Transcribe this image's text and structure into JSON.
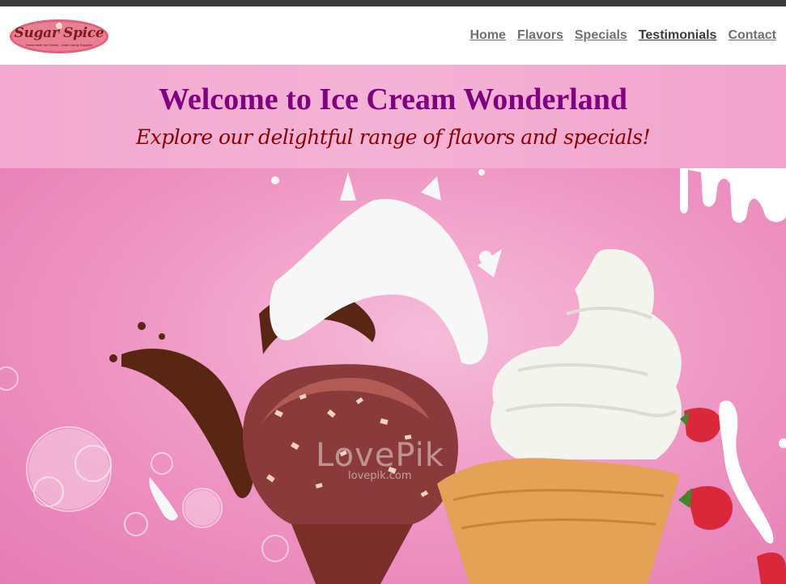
{
  "brand": {
    "logo_text": "Sugar Spice",
    "logo_tagline": "Homemade Ice Cream · Cake Candy Supplies"
  },
  "nav": {
    "items": [
      {
        "label": "Home"
      },
      {
        "label": "Flavors"
      },
      {
        "label": "Specials"
      },
      {
        "label": "Testimonials",
        "active": true
      },
      {
        "label": "Contact"
      }
    ]
  },
  "hero": {
    "title": "Welcome to Ice Cream Wonderland",
    "subtitle": "Explore our delightful range of flavors and specials!"
  },
  "image": {
    "watermark": "LovePik",
    "watermark_sub": "lovepik.com"
  },
  "colors": {
    "title": "#800080",
    "subtitle": "#8b0000",
    "band": "#f4b3d6",
    "nav_text": "#707070",
    "nav_active": "#3a3a3a"
  }
}
